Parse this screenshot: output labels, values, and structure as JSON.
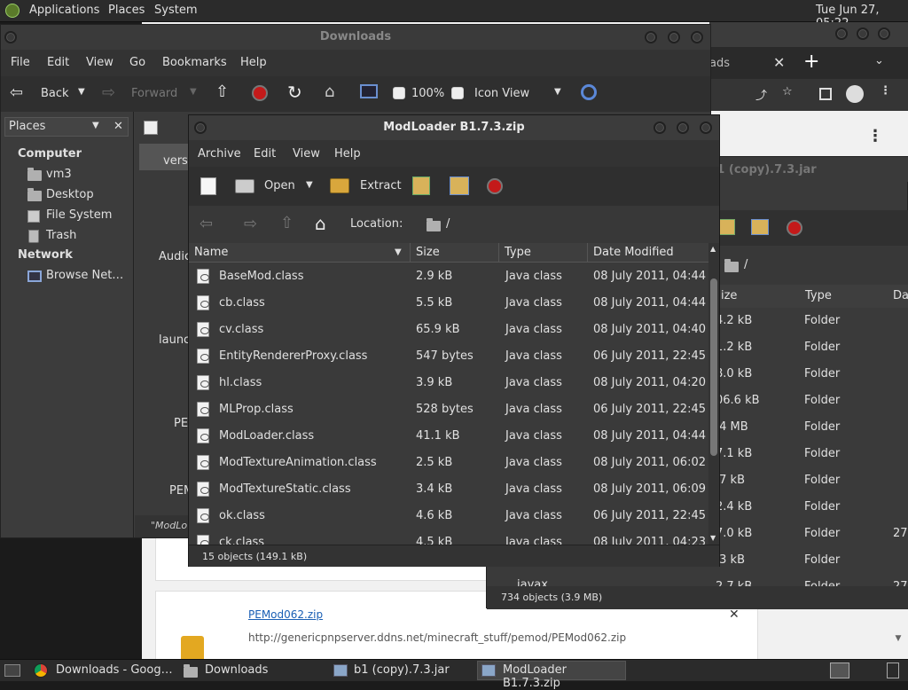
{
  "panel": {
    "menus": [
      "Applications",
      "Places",
      "System"
    ],
    "clock": "Tue Jun 27, 05:22"
  },
  "chrome": {
    "tab_fragment": "ads",
    "url_fragment": "(copy).7.3.jar",
    "download_name": "PEMod062.zip",
    "download_url": "http://genericpnpserver.ddns.net/minecraft_stuff/pemod/PEMod062.zip"
  },
  "nautilus": {
    "title": "Downloads",
    "menu": [
      "File",
      "Edit",
      "View",
      "Go",
      "Bookmarks",
      "Help"
    ],
    "toolbar": {
      "back": "Back",
      "forward": "Forward",
      "zoom": "100%",
      "view": "Icon View"
    },
    "sidebar": {
      "header": "Places",
      "group1": "Computer",
      "items1": [
        "vm3",
        "Desktop",
        "File System",
        "Trash"
      ],
      "group2": "Network",
      "items2": [
        "Browse Net…"
      ]
    },
    "content_fragments": [
      "versi",
      "Audic",
      "launc",
      "PE",
      "PEM",
      "\"ModLo"
    ]
  },
  "archive_back": {
    "title": "b1 (copy).7.3.jar",
    "location": "/",
    "columns": [
      "ize",
      "Type",
      "Da"
    ],
    "rows": [
      {
        "size": "4.2 kB",
        "type": "Folder",
        "date": ""
      },
      {
        "size": "1.2 kB",
        "type": "Folder",
        "date": ""
      },
      {
        "size": "8.0 kB",
        "type": "Folder",
        "date": ""
      },
      {
        "size": "06.6 kB",
        "type": "Folder",
        "date": ""
      },
      {
        "size": ".4 MB",
        "type": "Folder",
        "date": ""
      },
      {
        "size": "7.1 kB",
        "type": "Folder",
        "date": ""
      },
      {
        "size": ".7 kB",
        "type": "Folder",
        "date": ""
      },
      {
        "size": "2.4 kB",
        "type": "Folder",
        "date": ""
      },
      {
        "size": "7.0 kB",
        "type": "Folder",
        "date": "27."
      },
      {
        "size": ".3 kB",
        "type": "Folder",
        "date": ""
      },
      {
        "size": "2.7 kB",
        "type": "Folder",
        "date": "27."
      }
    ],
    "last_name": "javax",
    "status": "734 objects (3.9 MB)"
  },
  "archive": {
    "title": "ModLoader B1.7.3.zip",
    "menu": [
      "Archive",
      "Edit",
      "View",
      "Help"
    ],
    "toolbar": {
      "open": "Open",
      "extract": "Extract"
    },
    "location_label": "Location:",
    "location_path": "/",
    "columns": [
      "Name",
      "Size",
      "Type",
      "Date Modified"
    ],
    "rows": [
      {
        "name": "BaseMod.class",
        "size": "2.9 kB",
        "type": "Java class",
        "date": "08 July 2011, 04:44"
      },
      {
        "name": "cb.class",
        "size": "5.5 kB",
        "type": "Java class",
        "date": "08 July 2011, 04:44"
      },
      {
        "name": "cv.class",
        "size": "65.9 kB",
        "type": "Java class",
        "date": "08 July 2011, 04:40"
      },
      {
        "name": "EntityRendererProxy.class",
        "size": "547 bytes",
        "type": "Java class",
        "date": "06 July 2011, 22:45"
      },
      {
        "name": "hl.class",
        "size": "3.9 kB",
        "type": "Java class",
        "date": "08 July 2011, 04:20"
      },
      {
        "name": "MLProp.class",
        "size": "528 bytes",
        "type": "Java class",
        "date": "06 July 2011, 22:45"
      },
      {
        "name": "ModLoader.class",
        "size": "41.1 kB",
        "type": "Java class",
        "date": "08 July 2011, 04:44"
      },
      {
        "name": "ModTextureAnimation.class",
        "size": "2.5 kB",
        "type": "Java class",
        "date": "08 July 2011, 06:02"
      },
      {
        "name": "ModTextureStatic.class",
        "size": "3.4 kB",
        "type": "Java class",
        "date": "08 July 2011, 06:09"
      },
      {
        "name": "ok.class",
        "size": "4.6 kB",
        "type": "Java class",
        "date": "06 July 2011, 22:45"
      },
      {
        "name": "ck.class",
        "size": "4.5 kB",
        "type": "Java class",
        "date": "08 July 2011, 04:23"
      }
    ],
    "status": "15 objects (149.1 kB)"
  },
  "taskbar": {
    "items": [
      "Downloads - Googl…",
      "Downloads",
      "b1 (copy).7.3.jar",
      "ModLoader B1.7.3.zip"
    ]
  }
}
